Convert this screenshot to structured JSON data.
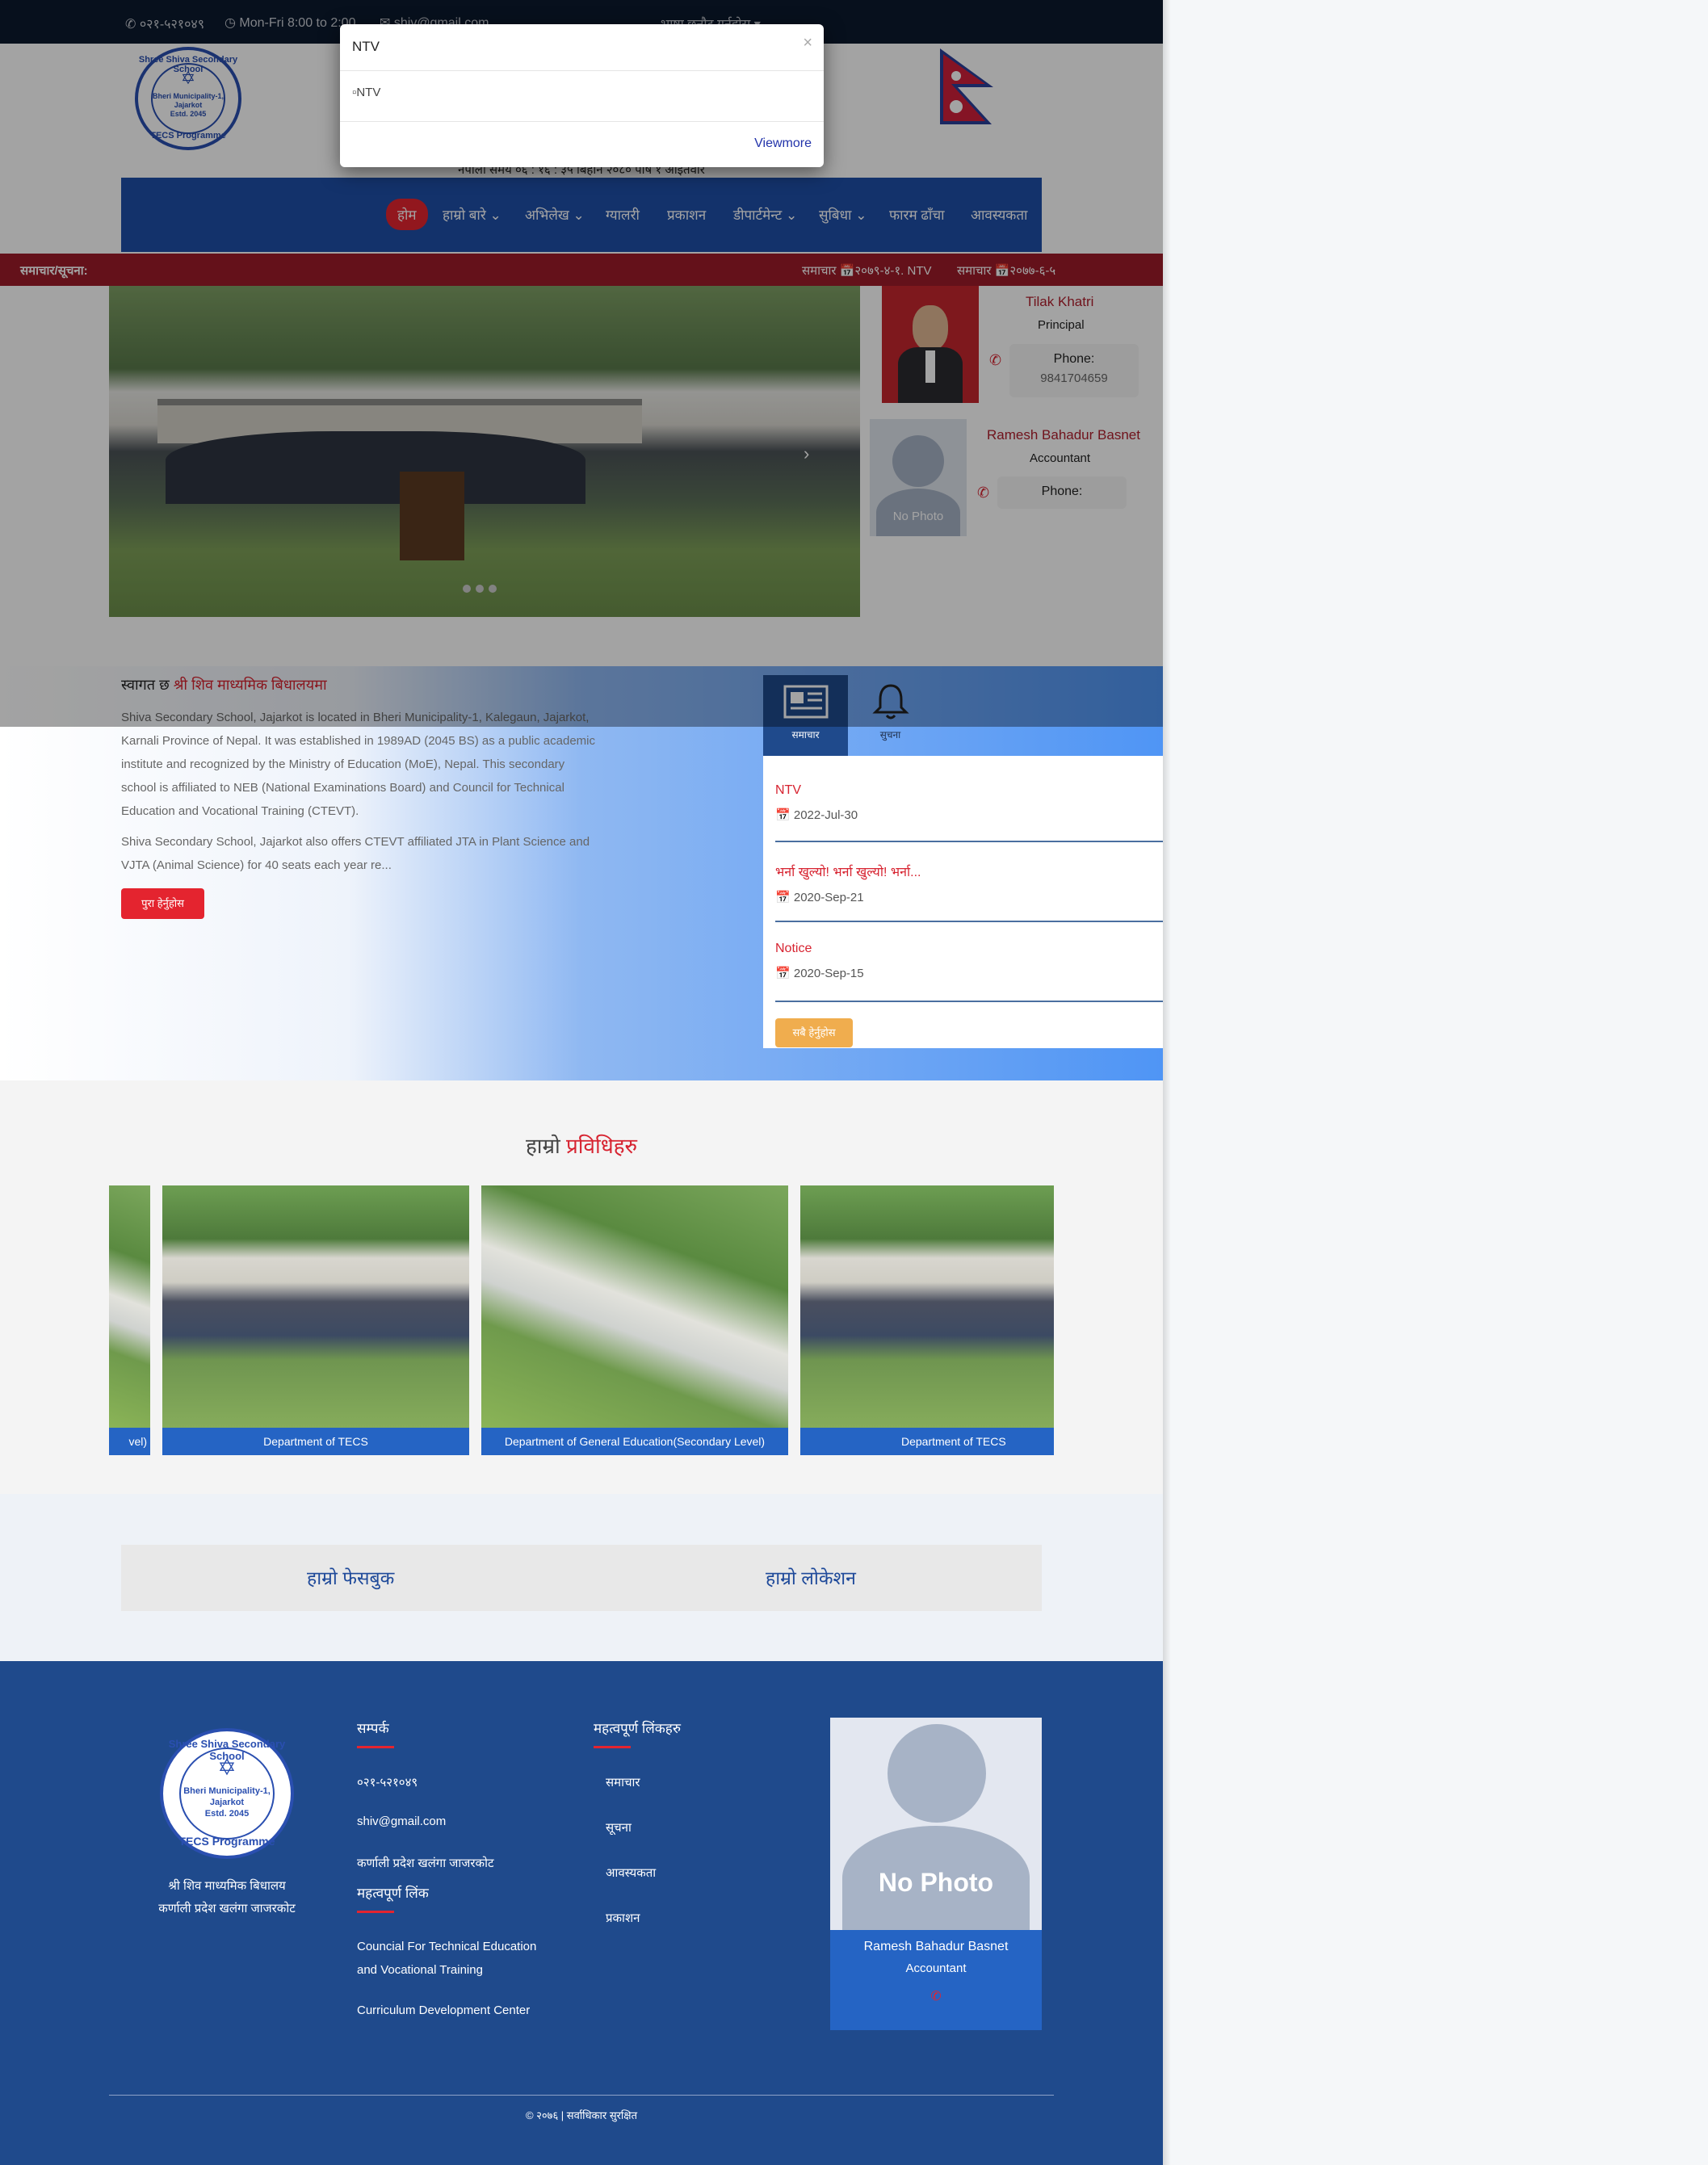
{
  "topbar": {
    "phone": "०२१-५२१०४९",
    "hours": "Mon-Fri 8:00 to 2:00",
    "email": "shiv@gmail.com",
    "language": "भाषा छनौट गर्नुहोस"
  },
  "header": {
    "logo": {
      "ring_top": "Shree Shiva Secondary School",
      "ring_bottom": "TECS Programme",
      "center1": "Bheri Municipality-1,",
      "center2": "Jajarkot",
      "center3": "Estd. 2045"
    },
    "date_line": "नेपाली समय ०६ : १६ : ३५ बिहान   २०८० पौष १ आइतवार"
  },
  "nav": {
    "items": [
      "होम",
      "हाम्रो बारे",
      "अभिलेख",
      "ग्यालरी",
      "प्रकाशन",
      "डीपार्टमेन्ट",
      "सुबिधा",
      "फारम ढाँचा",
      "आवस्यकता"
    ]
  },
  "ticker": {
    "label": "समाचार/सूचना:",
    "item1": "समाचार 📅२०७९-४-१. NTV",
    "item2": "समाचार 📅२०७७-६-५"
  },
  "staff": [
    {
      "name": "Tilak Khatri",
      "role": "Principal",
      "phone_label": "Phone:",
      "phone": "9841704659"
    },
    {
      "name": "Ramesh Bahadur Basnet",
      "role": "Accountant",
      "phone_label": "Phone:",
      "phone": "",
      "photo_text": "No Photo"
    }
  ],
  "welcome": {
    "prefix": "स्वागत छ ",
    "highlight": "श्री शिव माध्यमिक बिधालयमा",
    "para1": "Shiva Secondary School, Jajarkot is located in Bheri Municipality-1, Kalegaun, Jajarkot, Karnali Province of Nepal. It was established in 1989AD (2045 BS) as a public academic institute and recognized by the Ministry of Education (MoE), Nepal. This secondary school is affiliated to NEB (National Examinations Board) and Council for Technical Education and Vocational Training (CTEVT).",
    "para2": "Shiva  Secondary School, Jajarkot also offers CTEVT affiliated JTA in Plant Science and VJTA (Animal Science) for 40 seats each year re...",
    "read_more": "पुरा हेर्नुहोस"
  },
  "news_tabs": [
    {
      "label": "समाचार",
      "icon": "newspaper-icon"
    },
    {
      "label": "सुचना",
      "icon": "bell-icon"
    }
  ],
  "news": [
    {
      "title": "NTV",
      "date": "2022-Jul-30"
    },
    {
      "title": "भर्ना खुल्यो! भर्ना खुल्यो! भर्ना...",
      "date": "2020-Sep-21"
    },
    {
      "title": "Notice",
      "date": "2020-Sep-15"
    }
  ],
  "news_all": "सबै हेर्नुहोस",
  "faculty": {
    "title_a": "हाम्रो ",
    "title_b": "प्रविधिहरु",
    "cards": [
      "vel)",
      "Department of TECS",
      "Department of General Education(Secondary Level)",
      "Department of TECS"
    ]
  },
  "social": {
    "facebook": "हाम्रो फेसबुक",
    "location": "हाम्रो लोकेशन"
  },
  "footer": {
    "school_name": "श्री शिव माध्यमिक बिधालय",
    "school_addr": "कर्णाली प्रदेश खलंगा जाजरकोट",
    "contact_head": "सम्पर्क",
    "phone": "०२१-५२१०४९",
    "email": "shiv@gmail.com",
    "address": "कर्णाली प्रदेश खलंगा जाजरकोट",
    "links_head": "महत्वपूर्ण लिंक",
    "link1a": "Councial For Technical Education",
    "link1b": "and Vocational Training",
    "link2": "Curriculum Development Center",
    "imp_head": "महत्वपूर्ण लिंकहरु",
    "imp_links": [
      "समाचार",
      "सूचना",
      "आवस्यकता",
      "प्रकाशन"
    ],
    "card_photo_text": "No Photo",
    "card_name": "Ramesh Bahadur Basnet",
    "card_role": "Accountant",
    "copyright": "© २०७६ | सर्वाधिकार सुरक्षित"
  },
  "modal": {
    "title": "NTV",
    "close": "×",
    "image_alt": "NTV",
    "viewmore": "Viewmore"
  },
  "colors": {
    "navy": "#0c1a2e",
    "nav_blue": "#1f4fa8",
    "red": "#e4242f",
    "ticker": "#9d1c2a",
    "footer": "#1f4a8c",
    "orange": "#f0ad4e"
  }
}
